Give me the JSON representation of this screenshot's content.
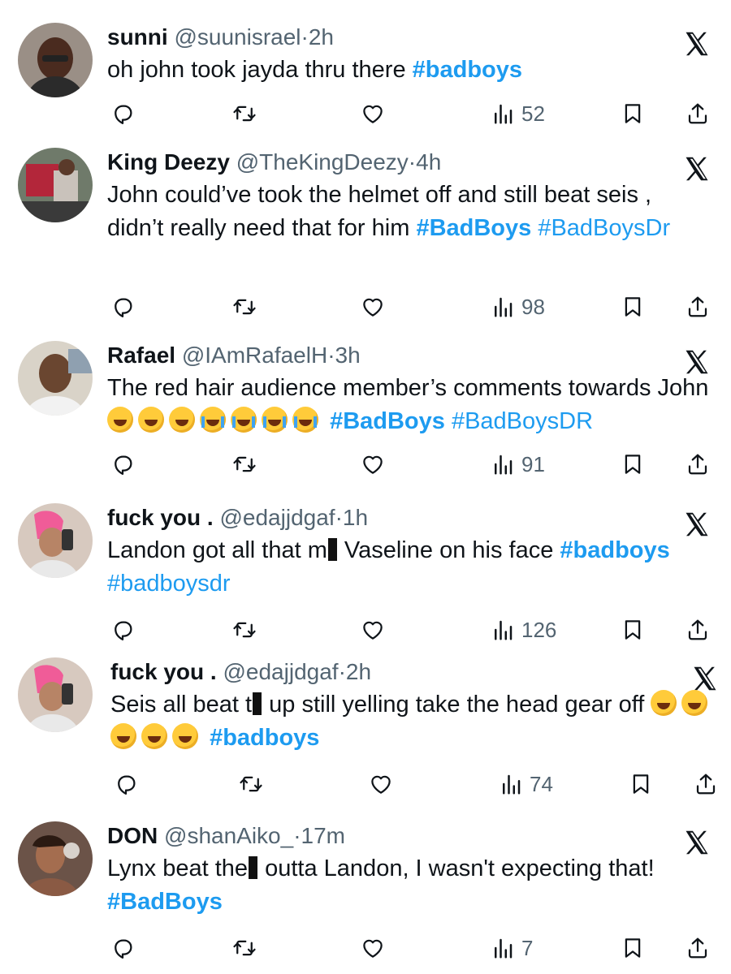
{
  "colors": {
    "link": "#1d9bf0",
    "text": "#0f1419",
    "muted": "#536471"
  },
  "icons": [
    "reply-icon",
    "retweet-icon",
    "like-icon",
    "views-icon",
    "bookmark-icon",
    "share-icon",
    "x-logo-icon"
  ],
  "tweets": [
    {
      "name": "sunni",
      "handle": "@suunisrael",
      "sep": "·",
      "time": "2h",
      "text1": "oh john took jayda thru there ",
      "tag1": "#badboys",
      "views": "52"
    },
    {
      "name": "King Deezy",
      "handle": "@TheKingDeezy",
      "sep": "·",
      "time": "4h",
      "text1": "John could’ve took the helmet off and still beat seis , didn’t really need that for him ",
      "tag1": "#BadBoys",
      "tag2": "#BadBoysDr",
      "views": "98"
    },
    {
      "name": "Rafael",
      "handle": "@IAmRafaelH",
      "sep": "·",
      "time": "3h",
      "text1": "The red hair audience member’s comments towards John ",
      "tag1": "#BadBoys",
      "tag2": "#BadBoysDR",
      "views": "91"
    },
    {
      "name": "fuck you .",
      "handle": "@edajjdgaf",
      "sep": "·",
      "time": "1h",
      "text1": "Landon got all that m",
      "text2": " Vaseline on his face ",
      "tag1": "#badboys",
      "tag2": "#badboysdr",
      "views": "126"
    },
    {
      "name": "fuck you .",
      "handle": "@edajjdgaf",
      "sep": "·",
      "time": "2h",
      "text1": "Seis all beat t",
      "text2": " up still yelling take the head gear off",
      "tag1": "#badboys",
      "views": "74"
    },
    {
      "name": "DON",
      "handle": "@shanAiko_",
      "sep": "·",
      "time": "17m",
      "text1": "Lynx beat the",
      "text2": " outta Landon, I wasn't expecting that!",
      "tag1": "#BadBoys",
      "views": "7"
    }
  ]
}
